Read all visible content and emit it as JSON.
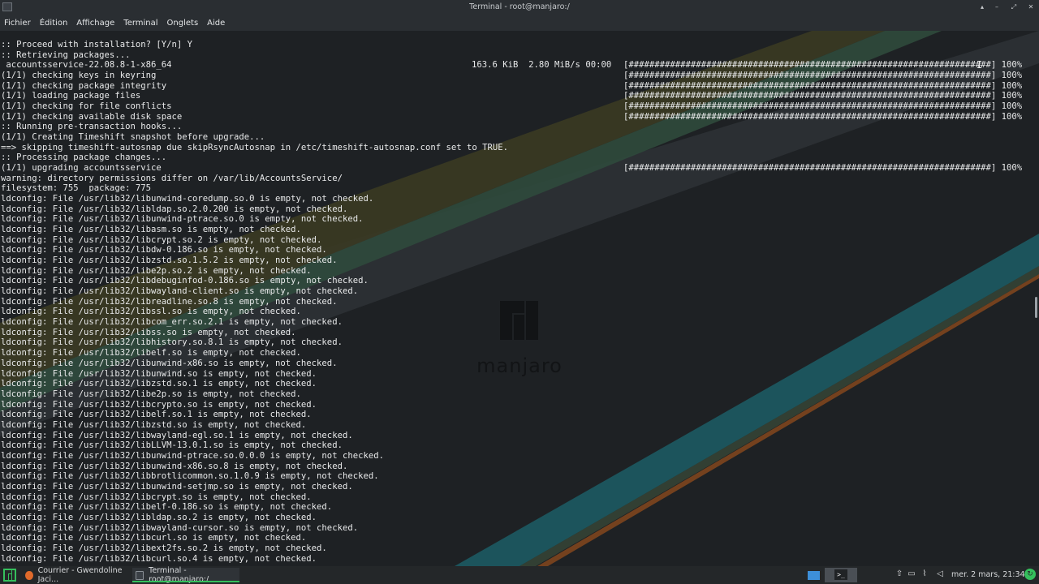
{
  "window": {
    "title": "Terminal - root@manjaro:/",
    "controls": [
      "▴",
      "–",
      "⤢",
      "✕"
    ]
  },
  "menu": [
    "Fichier",
    "Édition",
    "Affichage",
    "Terminal",
    "Onglets",
    "Aide"
  ],
  "wallpaper": {
    "logo_text": "manjaro"
  },
  "terminal_lines": [
    {
      "t": ":: Proceed with installation? [Y/n] Y"
    },
    {
      "t": ":: Retrieving packages..."
    },
    {
      "t": " accountsservice-22.08.8-1-x86_64",
      "r": "163.6 KiB  2.80 MiB/s 00:00",
      "p": "[######################################################################] 100%"
    },
    {
      "t": "(1/1) checking keys in keyring",
      "p": "[######################################################################] 100%"
    },
    {
      "t": "(1/1) checking package integrity",
      "p": "[######################################################################] 100%"
    },
    {
      "t": "(1/1) loading package files",
      "p": "[######################################################################] 100%"
    },
    {
      "t": "(1/1) checking for file conflicts",
      "p": "[######################################################################] 100%"
    },
    {
      "t": "(1/1) checking available disk space",
      "p": "[######################################################################] 100%"
    },
    {
      "t": ":: Running pre-transaction hooks..."
    },
    {
      "t": "(1/1) Creating Timeshift snapshot before upgrade..."
    },
    {
      "t": "==> skipping timeshift-autosnap due skipRsyncAutosnap in /etc/timeshift-autosnap.conf set to TRUE."
    },
    {
      "t": ":: Processing package changes..."
    },
    {
      "t": "(1/1) upgrading accountsservice",
      "p": "[######################################################################] 100%"
    },
    {
      "t": "warning: directory permissions differ on /var/lib/AccountsService/"
    },
    {
      "t": "filesystem: 755  package: 775"
    },
    {
      "t": "ldconfig: File /usr/lib32/libunwind-coredump.so.0 is empty, not checked."
    },
    {
      "t": "ldconfig: File /usr/lib32/libldap.so.2.0.200 is empty, not checked."
    },
    {
      "t": "ldconfig: File /usr/lib32/libunwind-ptrace.so.0 is empty, not checked."
    },
    {
      "t": "ldconfig: File /usr/lib32/libasm.so is empty, not checked."
    },
    {
      "t": "ldconfig: File /usr/lib32/libcrypt.so.2 is empty, not checked."
    },
    {
      "t": "ldconfig: File /usr/lib32/libdw-0.186.so is empty, not checked."
    },
    {
      "t": "ldconfig: File /usr/lib32/libzstd.so.1.5.2 is empty, not checked."
    },
    {
      "t": "ldconfig: File /usr/lib32/libe2p.so.2 is empty, not checked."
    },
    {
      "t": "ldconfig: File /usr/lib32/libdebuginfod-0.186.so is empty, not checked."
    },
    {
      "t": "ldconfig: File /usr/lib32/libwayland-client.so is empty, not checked."
    },
    {
      "t": "ldconfig: File /usr/lib32/libreadline.so.8 is empty, not checked."
    },
    {
      "t": "ldconfig: File /usr/lib32/libssl.so is empty, not checked."
    },
    {
      "t": "ldconfig: File /usr/lib32/libcom_err.so.2.1 is empty, not checked."
    },
    {
      "t": "ldconfig: File /usr/lib32/libss.so is empty, not checked."
    },
    {
      "t": "ldconfig: File /usr/lib32/libhistory.so.8.1 is empty, not checked."
    },
    {
      "t": "ldconfig: File /usr/lib32/libelf.so is empty, not checked."
    },
    {
      "t": "ldconfig: File /usr/lib32/libunwind-x86.so is empty, not checked."
    },
    {
      "t": "ldconfig: File /usr/lib32/libunwind.so is empty, not checked."
    },
    {
      "t": "ldconfig: File /usr/lib32/libzstd.so.1 is empty, not checked."
    },
    {
      "t": "ldconfig: File /usr/lib32/libe2p.so is empty, not checked."
    },
    {
      "t": "ldconfig: File /usr/lib32/libcrypto.so is empty, not checked."
    },
    {
      "t": "ldconfig: File /usr/lib32/libelf.so.1 is empty, not checked."
    },
    {
      "t": "ldconfig: File /usr/lib32/libzstd.so is empty, not checked."
    },
    {
      "t": "ldconfig: File /usr/lib32/libwayland-egl.so.1 is empty, not checked."
    },
    {
      "t": "ldconfig: File /usr/lib32/libLLVM-13.0.1.so is empty, not checked."
    },
    {
      "t": "ldconfig: File /usr/lib32/libunwind-ptrace.so.0.0.0 is empty, not checked."
    },
    {
      "t": "ldconfig: File /usr/lib32/libunwind-x86.so.8 is empty, not checked."
    },
    {
      "t": "ldconfig: File /usr/lib32/libbrotlicommon.so.1.0.9 is empty, not checked."
    },
    {
      "t": "ldconfig: File /usr/lib32/libunwind-setjmp.so is empty, not checked."
    },
    {
      "t": "ldconfig: File /usr/lib32/libcrypt.so is empty, not checked."
    },
    {
      "t": "ldconfig: File /usr/lib32/libelf-0.186.so is empty, not checked."
    },
    {
      "t": "ldconfig: File /usr/lib32/libldap.so.2 is empty, not checked."
    },
    {
      "t": "ldconfig: File /usr/lib32/libwayland-cursor.so is empty, not checked."
    },
    {
      "t": "ldconfig: File /usr/lib32/libcurl.so is empty, not checked."
    },
    {
      "t": "ldconfig: File /usr/lib32/libext2fs.so.2 is empty, not checked."
    },
    {
      "t": "ldconfig: File /usr/lib32/libcurl.so.4 is empty, not checked."
    }
  ],
  "taskbar": {
    "tasks": [
      {
        "label": "Courrier - Gwendoline Jaci..."
      },
      {
        "label": "Terminal - root@manjaro:/"
      }
    ],
    "clock": "mer. 2 mars, 21:34"
  }
}
